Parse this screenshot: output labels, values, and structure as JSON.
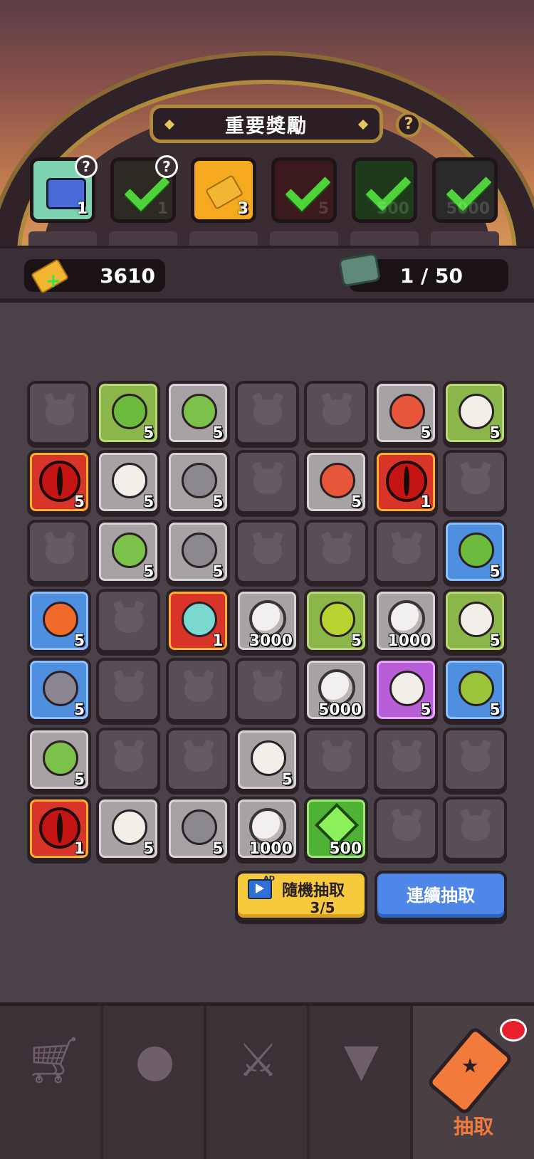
{
  "header": {
    "title": "重要獎勵",
    "help": "?"
  },
  "milestones": [
    {
      "count": "1",
      "help": "?",
      "claimed": false,
      "color": "#7ed4b0"
    },
    {
      "count": "1",
      "help": "?",
      "claimed": true,
      "color": "#2c2a22"
    },
    {
      "count": "3",
      "claimed": false,
      "color": "#f5a91f"
    },
    {
      "count": "5",
      "claimed": true,
      "color": "#3a1a1a"
    },
    {
      "count": "500",
      "claimed": true,
      "color": "#1e3a1a"
    },
    {
      "count": "5000",
      "claimed": true,
      "color": "#2a2a2a"
    }
  ],
  "resources": {
    "tickets": "3610",
    "stones": "1 / 50"
  },
  "board": [
    [
      {
        "t": "empty"
      },
      {
        "t": "green",
        "i": "goblin-bone-icon",
        "n": "5"
      },
      {
        "t": "gray",
        "i": "goblin-small-icon",
        "n": "5"
      },
      {
        "t": "empty"
      },
      {
        "t": "empty"
      },
      {
        "t": "gray",
        "i": "egg-icon",
        "n": "5"
      },
      {
        "t": "green",
        "i": "skull-warrior-icon",
        "n": "5"
      }
    ],
    [
      {
        "t": "red",
        "i": "eye-icon",
        "n": "5"
      },
      {
        "t": "gray",
        "i": "skull-icon",
        "n": "5"
      },
      {
        "t": "gray",
        "i": "crystal-rock-icon",
        "n": "5"
      },
      {
        "t": "empty"
      },
      {
        "t": "gray",
        "i": "egg-icon",
        "n": "5"
      },
      {
        "t": "red",
        "i": "eye-icon",
        "n": "1"
      },
      {
        "t": "empty"
      }
    ],
    [
      {
        "t": "empty"
      },
      {
        "t": "gray",
        "i": "goblin-small-icon",
        "n": "5"
      },
      {
        "t": "gray",
        "i": "sprout-rock-icon",
        "n": "5"
      },
      {
        "t": "empty"
      },
      {
        "t": "empty"
      },
      {
        "t": "empty"
      },
      {
        "t": "blue",
        "i": "goblin-shaman-icon",
        "n": "5"
      }
    ],
    [
      {
        "t": "blue",
        "i": "dragon-icon",
        "n": "5"
      },
      {
        "t": "empty"
      },
      {
        "t": "red",
        "i": "dragon-hero-icon",
        "n": "1"
      },
      {
        "t": "gray",
        "i": "coin-icon",
        "n": "3000"
      },
      {
        "t": "green",
        "i": "goblin-axe-icon",
        "n": "5"
      },
      {
        "t": "gray",
        "i": "coin-icon",
        "n": "1000"
      },
      {
        "t": "green",
        "i": "skull-warrior-icon",
        "n": "5"
      }
    ],
    [
      {
        "t": "blue",
        "i": "golem-icon",
        "n": "5"
      },
      {
        "t": "empty"
      },
      {
        "t": "empty"
      },
      {
        "t": "empty"
      },
      {
        "t": "gray",
        "i": "coin-icon",
        "n": "5000"
      },
      {
        "t": "purple",
        "i": "skull-blade-icon",
        "n": "5"
      },
      {
        "t": "blue",
        "i": "goblin-captain-icon",
        "n": "5"
      }
    ],
    [
      {
        "t": "gray",
        "i": "goblin-small-icon",
        "n": "5"
      },
      {
        "t": "empty"
      },
      {
        "t": "empty"
      },
      {
        "t": "gray",
        "i": "skull-small-icon",
        "n": "5"
      },
      {
        "t": "empty"
      },
      {
        "t": "empty"
      },
      {
        "t": "empty"
      }
    ],
    [
      {
        "t": "red",
        "i": "eye-icon",
        "n": "1"
      },
      {
        "t": "gray",
        "i": "skull-icon",
        "n": "5"
      },
      {
        "t": "gray",
        "i": "sprout-rock-icon",
        "n": "5"
      },
      {
        "t": "gray",
        "i": "coin-icon",
        "n": "1000"
      },
      {
        "t": "lime",
        "i": "gem-icon",
        "n": "500"
      },
      {
        "t": "empty"
      },
      {
        "t": "empty"
      }
    ]
  ],
  "actions": {
    "ad_draw": "隨機抽取",
    "ad_count": "3/5",
    "ad_tag": "AD",
    "continuous_draw": "連續抽取"
  },
  "nav": [
    {
      "icon": "cart-icon"
    },
    {
      "icon": "monster-icon"
    },
    {
      "icon": "swords-icon"
    },
    {
      "icon": "rank-icon"
    },
    {
      "icon": "draw-ticket-icon",
      "label": "抽取",
      "active": true
    }
  ]
}
